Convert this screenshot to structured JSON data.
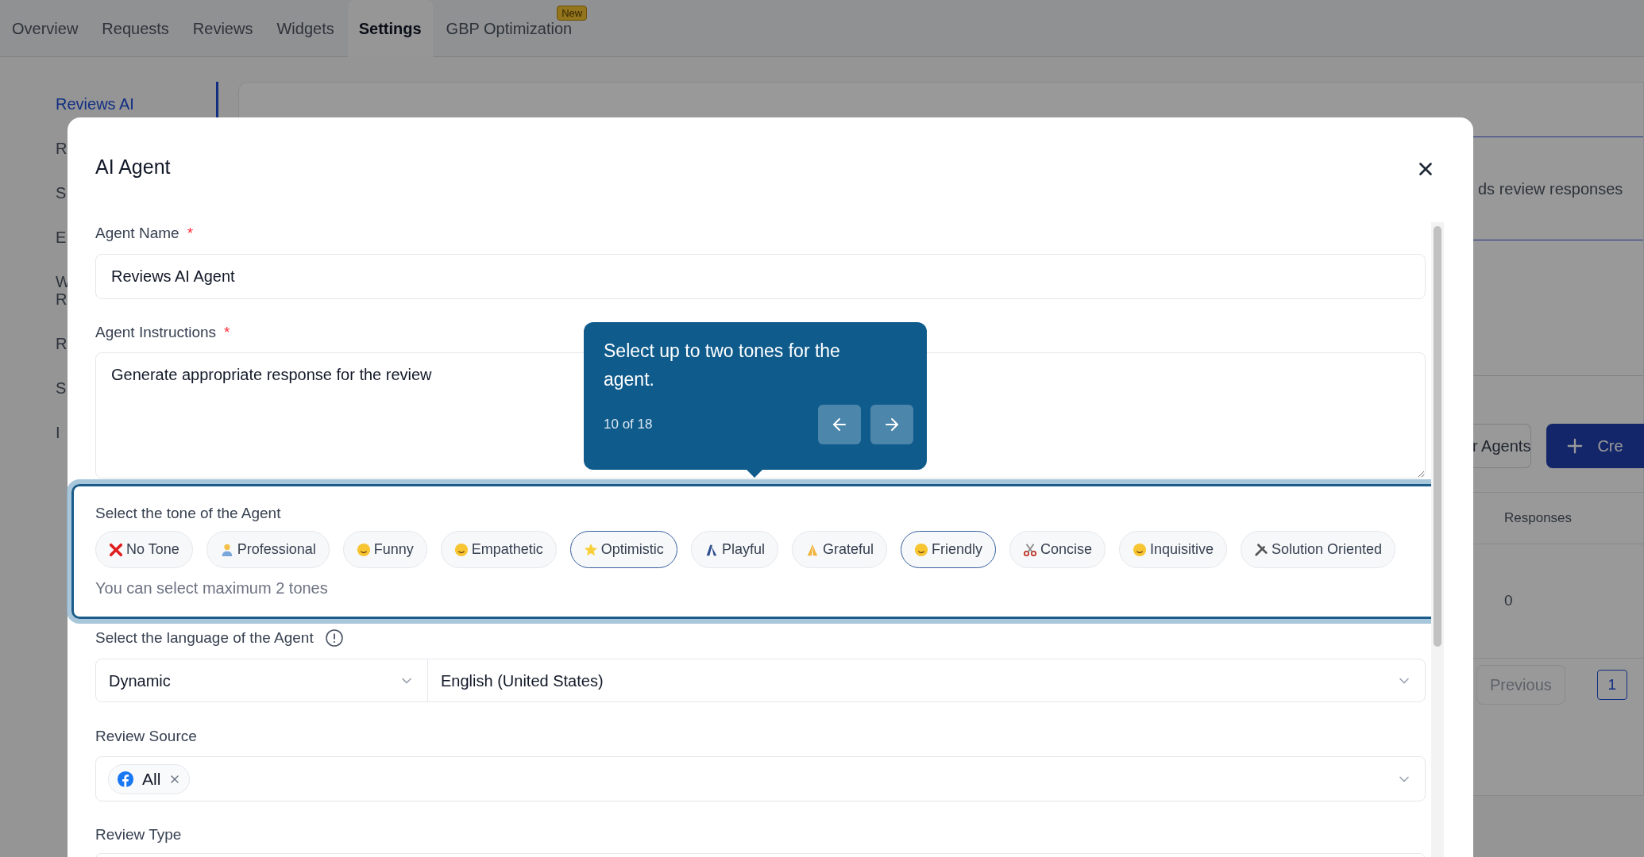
{
  "nav_tabs": [
    {
      "label": "Overview",
      "selected": false
    },
    {
      "label": "Requests",
      "selected": false
    },
    {
      "label": "Reviews",
      "selected": false
    },
    {
      "label": "Widgets",
      "selected": false
    },
    {
      "label": "Settings",
      "selected": true
    },
    {
      "label": "GBP Optimization",
      "selected": false,
      "badge": "New"
    }
  ],
  "sidebar": {
    "items": [
      {
        "lines": [
          "Reviews AI"
        ],
        "selected": true
      },
      {
        "lines": [
          "R"
        ],
        "selected": false
      },
      {
        "lines": [
          "S"
        ],
        "selected": false
      },
      {
        "lines": [
          "E"
        ],
        "selected": false
      },
      {
        "lines": [
          "W",
          "R"
        ],
        "selected": false
      },
      {
        "lines": [
          "R"
        ],
        "selected": false
      },
      {
        "lines": [
          "S"
        ],
        "selected": false
      },
      {
        "lines": [
          "I"
        ],
        "selected": false
      }
    ]
  },
  "page": {
    "description": "ds review responses",
    "filter_button": "r Agents",
    "create_button": "Cre",
    "table": {
      "columns": [
        "Responses"
      ],
      "rows": [
        [
          "0"
        ]
      ]
    },
    "pagination": {
      "previous": "Previous",
      "pages": [
        {
          "label": "1",
          "selected": true
        }
      ]
    }
  },
  "modal": {
    "title": "AI Agent",
    "agent_name": {
      "label": "Agent Name",
      "required_mark": "*",
      "value": "Reviews AI Agent"
    },
    "agent_instructions": {
      "label": "Agent Instructions",
      "required_mark": "*",
      "value": "Generate appropriate response for the review"
    },
    "tone": {
      "label": "Select the tone of the Agent",
      "highlighted": true,
      "options": [
        {
          "label": "No Tone",
          "selected": false
        },
        {
          "label": "Professional",
          "selected": false
        },
        {
          "label": "Funny",
          "selected": false
        },
        {
          "label": "Empathetic",
          "selected": false
        },
        {
          "label": "Optimistic",
          "selected": true
        },
        {
          "label": "Playful",
          "selected": false
        },
        {
          "label": "Grateful",
          "selected": false
        },
        {
          "label": "Friendly",
          "selected": true
        },
        {
          "label": "Concise",
          "selected": false
        },
        {
          "label": "Inquisitive",
          "selected": false
        },
        {
          "label": "Solution Oriented",
          "selected": false
        }
      ],
      "hint": "You can select maximum 2 tones"
    },
    "language": {
      "label": "Select the language of the Agent",
      "mode": "Dynamic",
      "value": "English (United States)"
    },
    "review_source": {
      "label": "Review Source",
      "chips": [
        {
          "label": "All"
        }
      ]
    },
    "review_type": {
      "label": "Review Type"
    }
  },
  "tooltip": {
    "text": "Select up to two tones for the agent.",
    "counter": "10 of 18"
  }
}
